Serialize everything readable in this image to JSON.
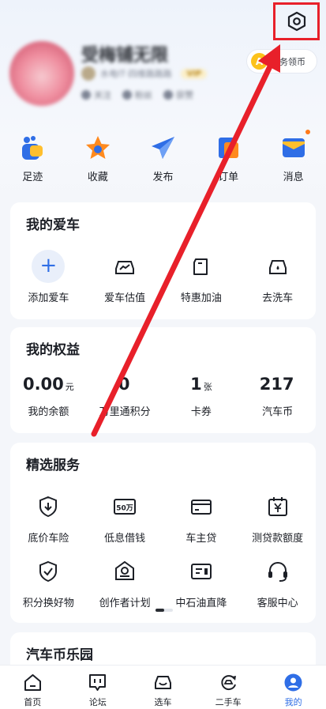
{
  "header": {
    "username": "受梅铺无限",
    "user_subtitle": "水电IT·四维路路路",
    "vip_label": "VIP",
    "user_stats": [
      "关注",
      "粉丝",
      "获赞"
    ],
    "task_coin_symbol": "A",
    "task_label": "任务领币"
  },
  "quick_links": [
    {
      "label": "足迹",
      "icon": "footprint-icon"
    },
    {
      "label": "收藏",
      "icon": "star-icon"
    },
    {
      "label": "发布",
      "icon": "send-icon"
    },
    {
      "label": "订单",
      "icon": "order-icon"
    },
    {
      "label": "消息",
      "icon": "message-icon"
    }
  ],
  "my_car": {
    "title": "我的爱车",
    "items": [
      {
        "label": "添加爱车",
        "icon": "plus-icon"
      },
      {
        "label": "爱车估值",
        "icon": "car-value-icon"
      },
      {
        "label": "特惠加油",
        "icon": "fuel-icon"
      },
      {
        "label": "去洗车",
        "icon": "car-wash-icon"
      }
    ]
  },
  "my_rights": {
    "title": "我的权益",
    "items": [
      {
        "value": "0.00",
        "unit": "元",
        "label": "我的余额"
      },
      {
        "value": "0",
        "unit": "",
        "label": "万里通积分"
      },
      {
        "value": "1",
        "unit": "张",
        "label": "卡券"
      },
      {
        "value": "217",
        "unit": "",
        "label": "汽车币"
      }
    ]
  },
  "services": {
    "title": "精选服务",
    "items": [
      {
        "label": "底价车险",
        "icon": "shield-down-icon"
      },
      {
        "label": "低息借钱",
        "icon": "loan-icon"
      },
      {
        "label": "车主贷",
        "icon": "card-icon"
      },
      {
        "label": "测贷款额度",
        "icon": "calendar-yen-icon"
      },
      {
        "label": "积分换好物",
        "icon": "shield-check-icon"
      },
      {
        "label": "创作者计划",
        "icon": "creator-icon"
      },
      {
        "label": "中石油直降",
        "icon": "fuel-card-icon"
      },
      {
        "label": "客服中心",
        "icon": "headset-icon"
      }
    ],
    "loan_icon_text": "50万"
  },
  "coin_park": {
    "title": "汽车币乐园"
  },
  "bottom_nav": [
    {
      "label": "首页",
      "icon": "home-icon"
    },
    {
      "label": "论坛",
      "icon": "forum-icon"
    },
    {
      "label": "选车",
      "icon": "car-select-icon"
    },
    {
      "label": "二手车",
      "icon": "used-car-icon"
    },
    {
      "label": "我的",
      "icon": "profile-icon",
      "active": true
    }
  ],
  "colors": {
    "accent": "#2f6ee6",
    "annotation": "#e8202a",
    "coin": "#fcc21b"
  }
}
